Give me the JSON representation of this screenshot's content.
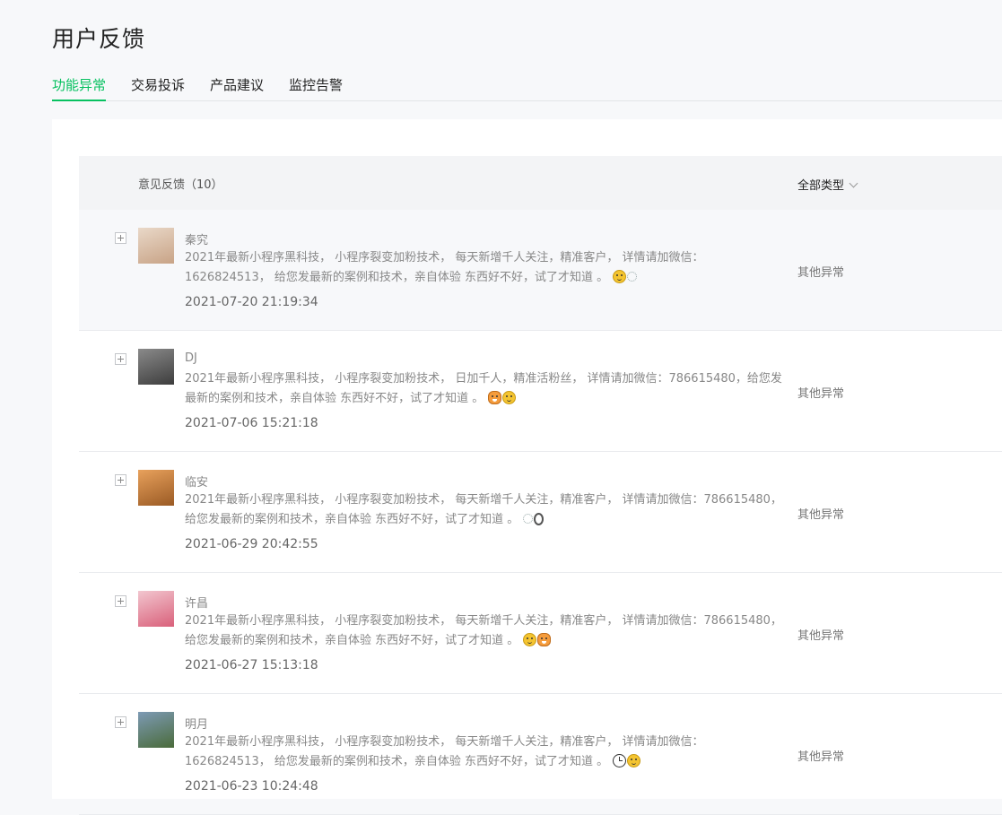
{
  "page": {
    "title": "用户反馈"
  },
  "tabs": [
    {
      "label": "功能异常",
      "active": true
    },
    {
      "label": "交易投诉",
      "active": false
    },
    {
      "label": "产品建议",
      "active": false
    },
    {
      "label": "监控告警",
      "active": false
    }
  ],
  "list": {
    "header_label": "意见反馈（10）",
    "type_filter": "全部类型",
    "rows": [
      {
        "nickname": "秦究",
        "content": "2021年最新小程序黑科技， 小程序裂变加粉技术， 每天新增千人关注，精准客户， 详情请加微信：1626824513， 给您发最新的案例和技术，亲自体验 东西好不好，试了才知道 。",
        "emojis": [
          "face",
          "flake"
        ],
        "time": "2021-07-20 21:19:34",
        "type": "其他异常",
        "avatar": "baby-photo",
        "colors": [
          "#e9d8c8",
          "#c8a386"
        ]
      },
      {
        "nickname": "DJ",
        "content": "2021年最新小程序黑科技， 小程序裂变加粉技术， 日加千人，精准活粉丝， 详情请加微信：786615480，给您发最新的案例和技术，亲自体验 东西好不好，试了才知道 。",
        "emojis": [
          "cat",
          "face"
        ],
        "time": "2021-07-06 15:21:18",
        "type": "其他异常",
        "avatar": "grey-photo",
        "colors": [
          "#8a8a8a",
          "#3d3d3d"
        ]
      },
      {
        "nickname": "临安",
        "content": "2021年最新小程序黑科技， 小程序裂变加粉技术， 每天新增千人关注，精准客户， 详情请加微信：786615480， 给您发最新的案例和技术，亲自体验 东西好不好，试了才知道 。",
        "emojis": [
          "flake",
          "ring"
        ],
        "time": "2021-06-29 20:42:55",
        "type": "其他异常",
        "avatar": "motocross-photo",
        "colors": [
          "#e8a15c",
          "#9a5a24"
        ]
      },
      {
        "nickname": "许昌",
        "content": "2021年最新小程序黑科技， 小程序裂变加粉技术， 每天新增千人关注，精准客户， 详情请加微信：786615480， 给您发最新的案例和技术，亲自体验 东西好不好，试了才知道 。",
        "emojis": [
          "face",
          "cat"
        ],
        "time": "2021-06-27 15:13:18",
        "type": "其他异常",
        "avatar": "flowers-photo",
        "colors": [
          "#f2c6cf",
          "#d9607a"
        ]
      },
      {
        "nickname": "明月",
        "content": "2021年最新小程序黑科技， 小程序裂变加粉技术， 每天新增千人关注，精准客户， 详情请加微信：1626824513， 给您发最新的案例和技术，亲自体验 东西好不好，试了才知道 。",
        "emojis": [
          "clock",
          "face"
        ],
        "time": "2021-06-23 10:24:48",
        "type": "其他异常",
        "avatar": "landscape-photo",
        "colors": [
          "#7d9ab5",
          "#4a6b3a"
        ]
      }
    ]
  },
  "colors": {
    "accent": "#07c160"
  }
}
